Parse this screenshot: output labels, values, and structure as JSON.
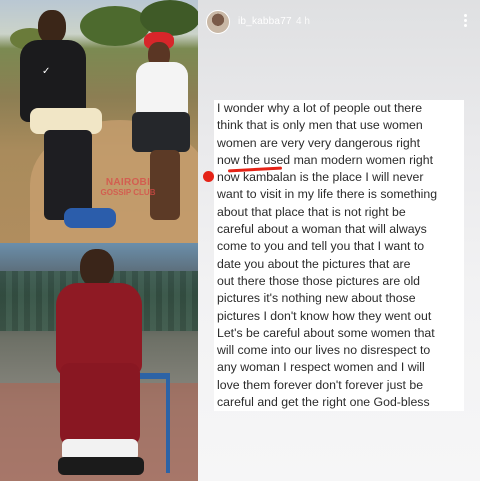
{
  "story": {
    "username": "ib_kabba77",
    "time": "4 h",
    "text_lines": [
      "I wonder why a lot of people out there",
      "think that is only men that use women",
      "women are very very dangerous right",
      "now the used man modern women right",
      "now kambalan is the place I will never",
      "want to visit in my life there is something",
      "about that place that is not right be",
      "careful about a woman that will always",
      "come to you and tell you that I want to",
      "date you about the pictures that are",
      "out there those those pictures are old",
      "pictures it's nothing new about those",
      "pictures I don't know how they went out",
      "Let's be careful about some women that",
      "will come into our lives no disrespect to",
      "any woman I respect women and I will",
      "love them forever don't forever just be",
      "careful and get the right one God-bless"
    ]
  },
  "photo_top": {
    "watermark_line1": "NAIROBI",
    "watermark_line2": "GOSSIP CLUB"
  },
  "icons": {
    "more": "more-vertical-icon",
    "avatar": "avatar"
  },
  "colors": {
    "annotation_red": "#e52317"
  }
}
